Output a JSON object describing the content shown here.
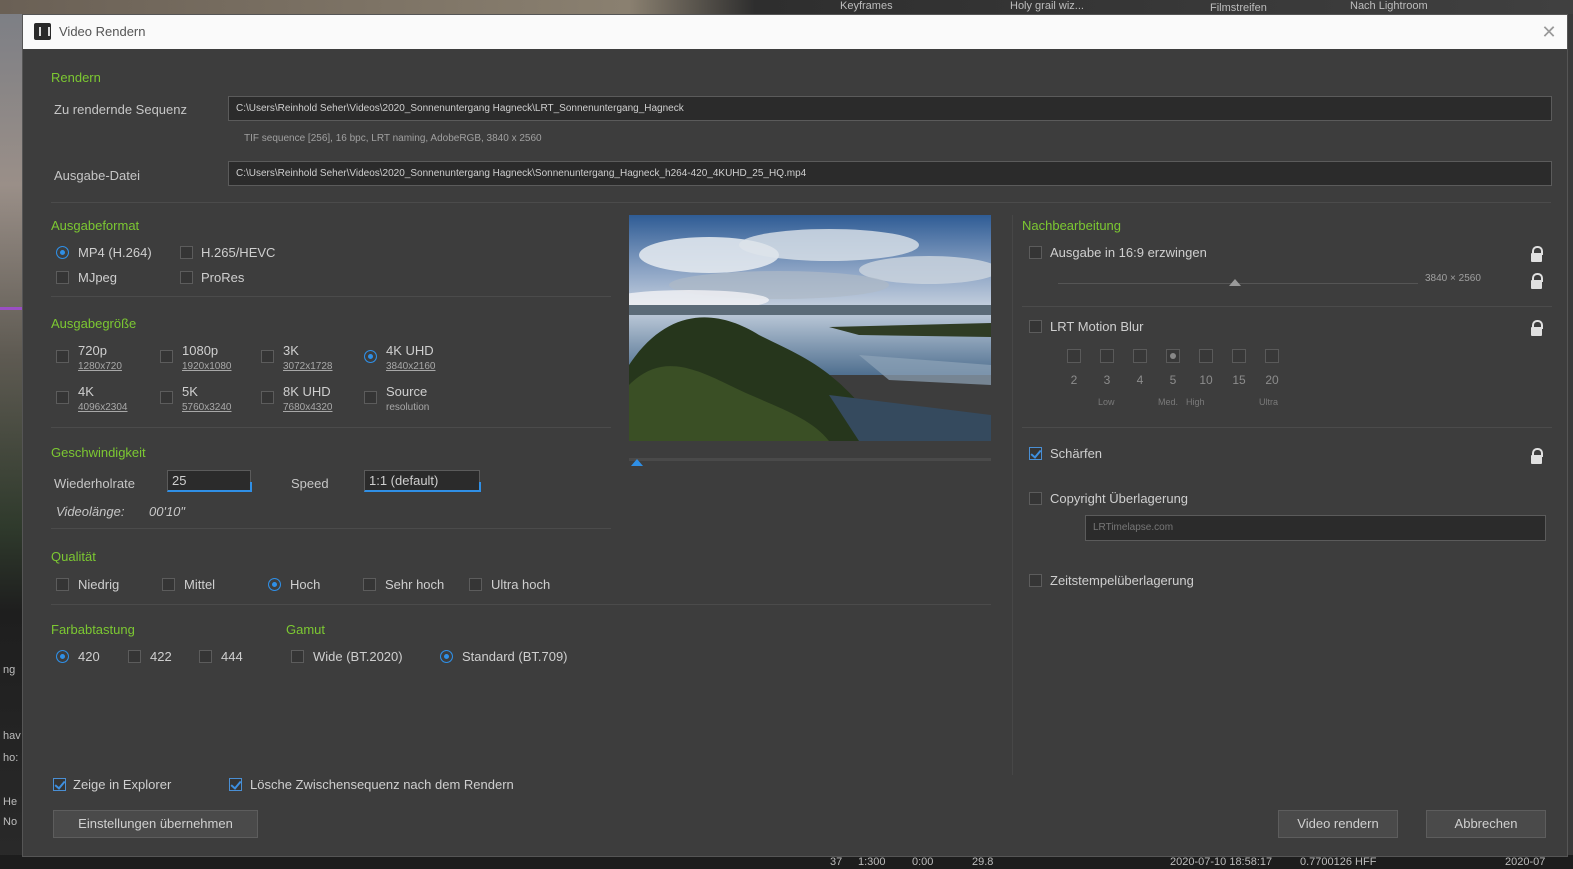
{
  "dialog": {
    "title": "Video Rendern",
    "close_glyph": "✕"
  },
  "render": {
    "heading": "Rendern",
    "sequence_label": "Zu rendernde Sequenz",
    "sequence_path": "C:\\Users\\Reinhold Seher\\Videos\\2020_Sonnenuntergang Hagneck\\LRT_Sonnenuntergang_Hagneck",
    "sequence_info": "TIF sequence [256], 16 bpc, LRT naming, AdobeRGB, 3840 x 2560",
    "output_label": "Ausgabe-Datei",
    "output_path": "C:\\Users\\Reinhold Seher\\Videos\\2020_Sonnenuntergang Hagneck\\Sonnenuntergang_Hagneck_h264-420_4KUHD_25_HQ.mp4"
  },
  "format": {
    "heading": "Ausgabeformat",
    "options": [
      "MP4 (H.264)",
      "H.265/HEVC",
      "MJpeg",
      "ProRes"
    ],
    "selected": "MP4 (H.264)"
  },
  "size": {
    "heading": "Ausgabegröße",
    "options": [
      {
        "label": "720p",
        "res": "1280x720"
      },
      {
        "label": "1080p",
        "res": "1920x1080"
      },
      {
        "label": "3K",
        "res": "3072x1728"
      },
      {
        "label": "4K UHD",
        "res": "3840x2160"
      },
      {
        "label": "4K",
        "res": "4096x2304"
      },
      {
        "label": "5K",
        "res": "5760x3240"
      },
      {
        "label": "8K UHD",
        "res": "7680x4320"
      },
      {
        "label": "Source",
        "res": "resolution"
      }
    ],
    "selected": "4K UHD"
  },
  "speed": {
    "heading": "Geschwindigkeit",
    "fps_label": "Wiederholrate",
    "fps_value": "25",
    "speed_label": "Speed",
    "speed_value": "1:1 (default)",
    "length_label": "Videolänge:",
    "length_value": "00'10\""
  },
  "quality": {
    "heading": "Qualität",
    "options": [
      "Niedrig",
      "Mittel",
      "Hoch",
      "Sehr hoch",
      "Ultra hoch"
    ],
    "selected": "Hoch"
  },
  "chroma": {
    "heading": "Farbabtastung",
    "options": [
      "420",
      "422",
      "444"
    ],
    "selected": "420"
  },
  "gamut": {
    "heading": "Gamut",
    "options": [
      "Wide (BT.2020)",
      "Standard (BT.709)"
    ],
    "selected": "Standard (BT.709)"
  },
  "post": {
    "heading": "Nachbearbeitung",
    "force169_label": "Ausgabe in 16:9 erzwingen",
    "force169_checked": false,
    "force169_dims": "3840 × 2560",
    "motion_blur_label": "LRT Motion Blur",
    "motion_blur_checked": false,
    "blur_values": [
      "2",
      "3",
      "4",
      "5",
      "10",
      "15",
      "20"
    ],
    "blur_selected": "5",
    "blur_tags": [
      "Low",
      "Med.",
      "High",
      "Ultra"
    ],
    "sharpen_label": "Schärfen",
    "sharpen_checked": true,
    "copyright_label": "Copyright Überlagerung",
    "copyright_checked": false,
    "copyright_placeholder": "LRTimelapse.com",
    "timestamp_label": "Zeitstempelüberlagerung",
    "timestamp_checked": false
  },
  "footer": {
    "show_explorer_label": "Zeige in Explorer",
    "show_explorer_checked": true,
    "delete_intermediate_label": "Lösche Zwischensequenz nach dem Rendern",
    "delete_intermediate_checked": true,
    "apply_settings": "Einstellungen übernehmen",
    "render_video": "Video rendern",
    "cancel": "Abbrechen"
  },
  "background": {
    "top_labels": [
      "Keyframes",
      "Holy grail wiz...",
      "Filmstreifen",
      "Nach Lightroom"
    ],
    "left_labels": [
      "ng",
      "hav",
      "ho:",
      "He",
      "No"
    ],
    "bottom_labels": [
      "37",
      "1:300",
      "0:00",
      "29.8",
      "2020-07-10 18:58:17",
      "0.7700126 HFF",
      "2020-07"
    ]
  },
  "colors": {
    "accent": "#2f8fe6",
    "heading_green": "#7cc832",
    "panel": "#3d3d3d"
  }
}
